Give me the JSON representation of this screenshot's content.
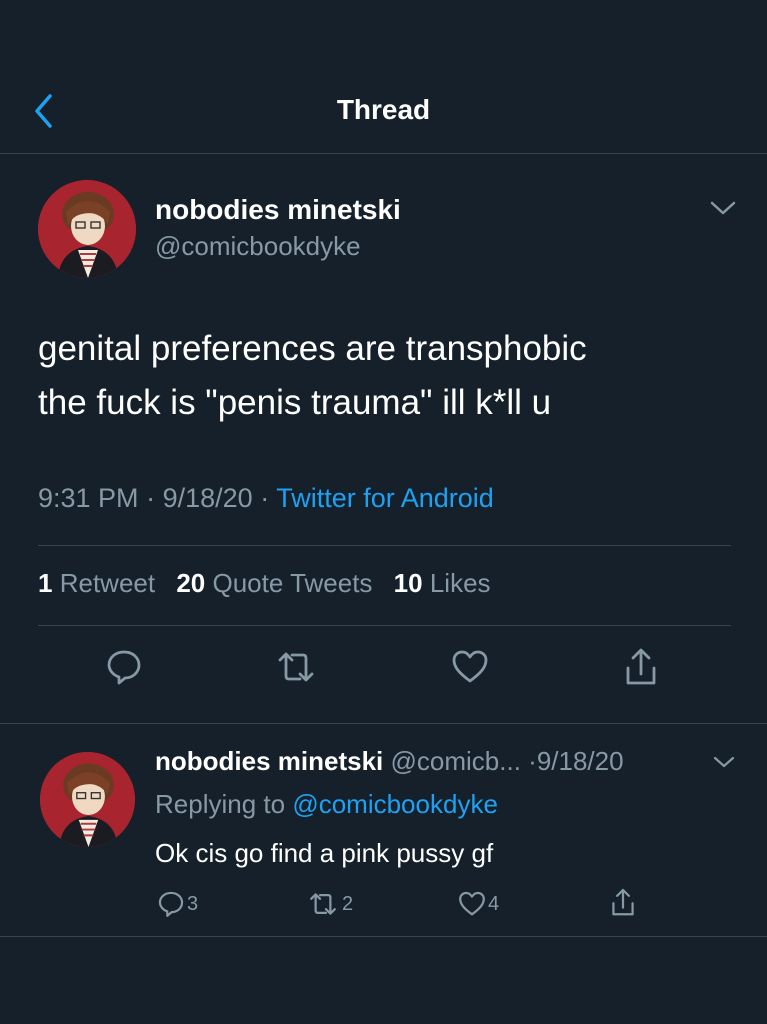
{
  "header": {
    "title": "Thread"
  },
  "main_tweet": {
    "display_name": "nobodies minetski",
    "handle": "@comicbookdyke",
    "text_line1": "genital preferences are transphobic",
    "text_line2": "the fuck is \"penis trauma\" ill k*ll u",
    "time": "9:31 PM",
    "date": "9/18/20",
    "client": "Twitter for Android",
    "separator": "·",
    "stats": {
      "retweets_count": "1",
      "retweets_label": "Retweet",
      "quotes_count": "20",
      "quotes_label": "Quote Tweets",
      "likes_count": "10",
      "likes_label": "Likes"
    }
  },
  "reply": {
    "display_name": "nobodies minetski",
    "handle": "@comicb...",
    "date": "·9/18/20",
    "replying_prefix": "Replying to",
    "replying_handle": "@comicbookdyke",
    "text": "Ok cis go find a pink pussy gf",
    "reply_count": "3",
    "retweet_count": "2",
    "like_count": "4"
  },
  "colors": {
    "background": "#15202b",
    "accent": "#1da1f2",
    "muted": "#8899a6",
    "divider": "#38444d"
  },
  "icons": [
    "chevron-left-icon",
    "chevron-down-icon",
    "reply-icon",
    "retweet-icon",
    "heart-icon",
    "share-icon"
  ]
}
